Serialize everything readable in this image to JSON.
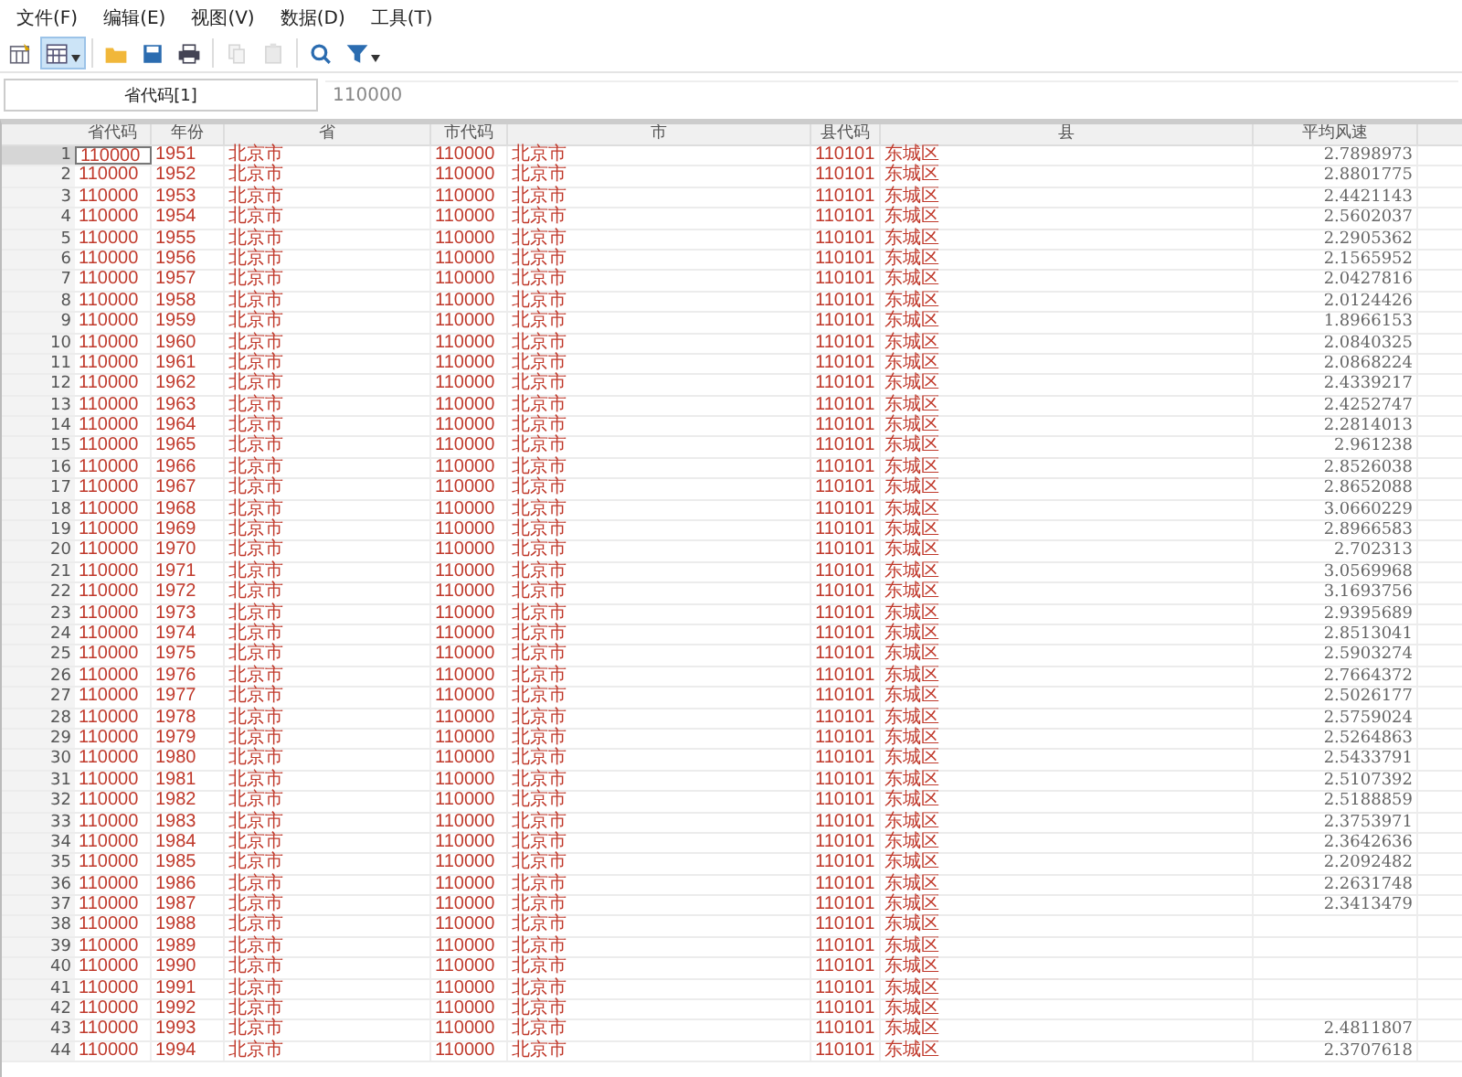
{
  "menu": [
    "文件(F)",
    "编辑(E)",
    "视图(V)",
    "数据(D)",
    "工具(T)"
  ],
  "toolbar": [
    {
      "kind": "edit",
      "selected": false,
      "disabled": false,
      "dropdown": false
    },
    {
      "kind": "browse",
      "selected": true,
      "disabled": false,
      "dropdown": true
    },
    {
      "kind": "open",
      "selected": false,
      "disabled": false,
      "dropdown": false
    },
    {
      "kind": "save",
      "selected": false,
      "disabled": false,
      "dropdown": false
    },
    {
      "kind": "print",
      "selected": false,
      "disabled": false,
      "dropdown": false
    },
    {
      "kind": "copy",
      "selected": false,
      "disabled": true,
      "dropdown": false
    },
    {
      "kind": "paste",
      "selected": false,
      "disabled": true,
      "dropdown": false
    },
    {
      "kind": "search",
      "selected": false,
      "disabled": false,
      "dropdown": false
    },
    {
      "kind": "filter",
      "selected": false,
      "disabled": false,
      "dropdown": true
    }
  ],
  "cell_bar": {
    "name": "省代码[1]",
    "value": "110000"
  },
  "table": {
    "columns": [
      "省代码",
      "年份",
      "省",
      "市代码",
      "市",
      "县代码",
      "县",
      "平均风速"
    ],
    "rows": [
      {
        "n": "1",
        "selected": true,
        "cells": [
          "110000",
          "1951",
          "北京市",
          "110000",
          "北京市",
          "110101",
          "东城区",
          "2.7898973"
        ]
      },
      {
        "n": "2",
        "selected": false,
        "cells": [
          "110000",
          "1952",
          "北京市",
          "110000",
          "北京市",
          "110101",
          "东城区",
          "2.8801775"
        ]
      },
      {
        "n": "3",
        "selected": false,
        "cells": [
          "110000",
          "1953",
          "北京市",
          "110000",
          "北京市",
          "110101",
          "东城区",
          "2.4421143"
        ]
      },
      {
        "n": "4",
        "selected": false,
        "cells": [
          "110000",
          "1954",
          "北京市",
          "110000",
          "北京市",
          "110101",
          "东城区",
          "2.5602037"
        ]
      },
      {
        "n": "5",
        "selected": false,
        "cells": [
          "110000",
          "1955",
          "北京市",
          "110000",
          "北京市",
          "110101",
          "东城区",
          "2.2905362"
        ]
      },
      {
        "n": "6",
        "selected": false,
        "cells": [
          "110000",
          "1956",
          "北京市",
          "110000",
          "北京市",
          "110101",
          "东城区",
          "2.1565952"
        ]
      },
      {
        "n": "7",
        "selected": false,
        "cells": [
          "110000",
          "1957",
          "北京市",
          "110000",
          "北京市",
          "110101",
          "东城区",
          "2.0427816"
        ]
      },
      {
        "n": "8",
        "selected": false,
        "cells": [
          "110000",
          "1958",
          "北京市",
          "110000",
          "北京市",
          "110101",
          "东城区",
          "2.0124426"
        ]
      },
      {
        "n": "9",
        "selected": false,
        "cells": [
          "110000",
          "1959",
          "北京市",
          "110000",
          "北京市",
          "110101",
          "东城区",
          "1.8966153"
        ]
      },
      {
        "n": "10",
        "selected": false,
        "cells": [
          "110000",
          "1960",
          "北京市",
          "110000",
          "北京市",
          "110101",
          "东城区",
          "2.0840325"
        ]
      },
      {
        "n": "11",
        "selected": false,
        "cells": [
          "110000",
          "1961",
          "北京市",
          "110000",
          "北京市",
          "110101",
          "东城区",
          "2.0868224"
        ]
      },
      {
        "n": "12",
        "selected": false,
        "cells": [
          "110000",
          "1962",
          "北京市",
          "110000",
          "北京市",
          "110101",
          "东城区",
          "2.4339217"
        ]
      },
      {
        "n": "13",
        "selected": false,
        "cells": [
          "110000",
          "1963",
          "北京市",
          "110000",
          "北京市",
          "110101",
          "东城区",
          "2.4252747"
        ]
      },
      {
        "n": "14",
        "selected": false,
        "cells": [
          "110000",
          "1964",
          "北京市",
          "110000",
          "北京市",
          "110101",
          "东城区",
          "2.2814013"
        ]
      },
      {
        "n": "15",
        "selected": false,
        "cells": [
          "110000",
          "1965",
          "北京市",
          "110000",
          "北京市",
          "110101",
          "东城区",
          "2.961238"
        ]
      },
      {
        "n": "16",
        "selected": false,
        "cells": [
          "110000",
          "1966",
          "北京市",
          "110000",
          "北京市",
          "110101",
          "东城区",
          "2.8526038"
        ]
      },
      {
        "n": "17",
        "selected": false,
        "cells": [
          "110000",
          "1967",
          "北京市",
          "110000",
          "北京市",
          "110101",
          "东城区",
          "2.8652088"
        ]
      },
      {
        "n": "18",
        "selected": false,
        "cells": [
          "110000",
          "1968",
          "北京市",
          "110000",
          "北京市",
          "110101",
          "东城区",
          "3.0660229"
        ]
      },
      {
        "n": "19",
        "selected": false,
        "cells": [
          "110000",
          "1969",
          "北京市",
          "110000",
          "北京市",
          "110101",
          "东城区",
          "2.8966583"
        ]
      },
      {
        "n": "20",
        "selected": false,
        "cells": [
          "110000",
          "1970",
          "北京市",
          "110000",
          "北京市",
          "110101",
          "东城区",
          "2.702313"
        ]
      },
      {
        "n": "21",
        "selected": false,
        "cells": [
          "110000",
          "1971",
          "北京市",
          "110000",
          "北京市",
          "110101",
          "东城区",
          "3.0569968"
        ]
      },
      {
        "n": "22",
        "selected": false,
        "cells": [
          "110000",
          "1972",
          "北京市",
          "110000",
          "北京市",
          "110101",
          "东城区",
          "3.1693756"
        ]
      },
      {
        "n": "23",
        "selected": false,
        "cells": [
          "110000",
          "1973",
          "北京市",
          "110000",
          "北京市",
          "110101",
          "东城区",
          "2.9395689"
        ]
      },
      {
        "n": "24",
        "selected": false,
        "cells": [
          "110000",
          "1974",
          "北京市",
          "110000",
          "北京市",
          "110101",
          "东城区",
          "2.8513041"
        ]
      },
      {
        "n": "25",
        "selected": false,
        "cells": [
          "110000",
          "1975",
          "北京市",
          "110000",
          "北京市",
          "110101",
          "东城区",
          "2.5903274"
        ]
      },
      {
        "n": "26",
        "selected": false,
        "cells": [
          "110000",
          "1976",
          "北京市",
          "110000",
          "北京市",
          "110101",
          "东城区",
          "2.7664372"
        ]
      },
      {
        "n": "27",
        "selected": false,
        "cells": [
          "110000",
          "1977",
          "北京市",
          "110000",
          "北京市",
          "110101",
          "东城区",
          "2.5026177"
        ]
      },
      {
        "n": "28",
        "selected": false,
        "cells": [
          "110000",
          "1978",
          "北京市",
          "110000",
          "北京市",
          "110101",
          "东城区",
          "2.5759024"
        ]
      },
      {
        "n": "29",
        "selected": false,
        "cells": [
          "110000",
          "1979",
          "北京市",
          "110000",
          "北京市",
          "110101",
          "东城区",
          "2.5264863"
        ]
      },
      {
        "n": "30",
        "selected": false,
        "cells": [
          "110000",
          "1980",
          "北京市",
          "110000",
          "北京市",
          "110101",
          "东城区",
          "2.5433791"
        ]
      },
      {
        "n": "31",
        "selected": false,
        "cells": [
          "110000",
          "1981",
          "北京市",
          "110000",
          "北京市",
          "110101",
          "东城区",
          "2.5107392"
        ]
      },
      {
        "n": "32",
        "selected": false,
        "cells": [
          "110000",
          "1982",
          "北京市",
          "110000",
          "北京市",
          "110101",
          "东城区",
          "2.5188859"
        ]
      },
      {
        "n": "33",
        "selected": false,
        "cells": [
          "110000",
          "1983",
          "北京市",
          "110000",
          "北京市",
          "110101",
          "东城区",
          "2.3753971"
        ]
      },
      {
        "n": "34",
        "selected": false,
        "cells": [
          "110000",
          "1984",
          "北京市",
          "110000",
          "北京市",
          "110101",
          "东城区",
          "2.3642636"
        ]
      },
      {
        "n": "35",
        "selected": false,
        "cells": [
          "110000",
          "1985",
          "北京市",
          "110000",
          "北京市",
          "110101",
          "东城区",
          "2.2092482"
        ]
      },
      {
        "n": "36",
        "selected": false,
        "cells": [
          "110000",
          "1986",
          "北京市",
          "110000",
          "北京市",
          "110101",
          "东城区",
          "2.2631748"
        ]
      },
      {
        "n": "37",
        "selected": false,
        "cells": [
          "110000",
          "1987",
          "北京市",
          "110000",
          "北京市",
          "110101",
          "东城区",
          "2.3413479"
        ]
      },
      {
        "n": "38",
        "selected": false,
        "cells": [
          "110000",
          "1988",
          "北京市",
          "110000",
          "北京市",
          "110101",
          "东城区"
        ]
      },
      {
        "n": "39",
        "selected": false,
        "cells": [
          "110000",
          "1989",
          "北京市",
          "110000",
          "北京市",
          "110101",
          "东城区"
        ]
      },
      {
        "n": "40",
        "selected": false,
        "cells": [
          "110000",
          "1990",
          "北京市",
          "110000",
          "北京市",
          "110101",
          "东城区"
        ]
      },
      {
        "n": "41",
        "selected": false,
        "cells": [
          "110000",
          "1991",
          "北京市",
          "110000",
          "北京市",
          "110101",
          "东城区"
        ]
      },
      {
        "n": "42",
        "selected": false,
        "cells": [
          "110000",
          "1992",
          "北京市",
          "110000",
          "北京市",
          "110101",
          "东城区"
        ]
      },
      {
        "n": "43",
        "selected": false,
        "cells": [
          "110000",
          "1993",
          "北京市",
          "110000",
          "北京市",
          "110101",
          "东城区",
          "2.4811807"
        ]
      },
      {
        "n": "44",
        "selected": false,
        "cells": [
          "110000",
          "1994",
          "北京市",
          "110000",
          "北京市",
          "110101",
          "东城区",
          "2.3707618"
        ]
      }
    ]
  }
}
